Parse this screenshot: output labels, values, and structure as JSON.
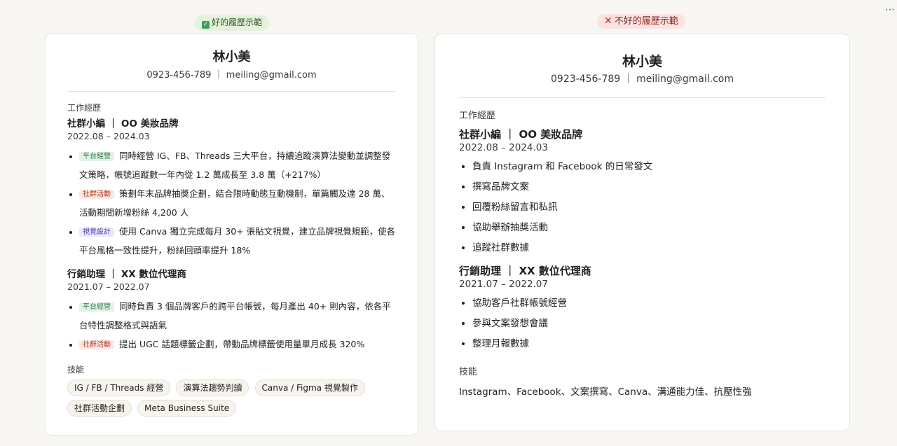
{
  "good_label": "好的履歷示範",
  "bad_label": "不好的履歷示範",
  "more_icon": "⋯",
  "good": {
    "name": "林小美",
    "contact": "0923-456-789 ｜ meiling@gmail.com",
    "section_work": "工作經歷",
    "jobs": [
      {
        "title": "社群小編 ｜ OO 美妝品牌",
        "period": "2022.08 – 2024.03",
        "bullets": [
          {
            "tag": "平台經營",
            "tag_color": "green",
            "text": "同時經營 IG、FB、Threads 三大平台，持續追蹤演算法變動並調整發文策略，帳號追蹤數一年內從 1.2 萬成長至 3.8 萬（+217%）"
          },
          {
            "tag": "社群活動",
            "tag_color": "red",
            "text": "策劃年末品牌抽獎企劃，結合限時動態互動機制，單篇觸及達 28 萬、活動期間新增粉絲 4,200 人"
          },
          {
            "tag": "視覺設計",
            "tag_color": "purple",
            "text": "使用 Canva 獨立完成每月 30+ 張貼文視覺，建立品牌視覺規範，使各平台風格一致性提升，粉絲回頭率提升 18%"
          }
        ]
      },
      {
        "title": "行銷助理 ｜ XX 數位代理商",
        "period": "2021.07 – 2022.07",
        "bullets": [
          {
            "tag": "平台經營",
            "tag_color": "green",
            "text": "同時負責 3 個品牌客戶的跨平台帳號，每月產出 40+ 則內容，依各平台特性調整格式與語氣"
          },
          {
            "tag": "社群活動",
            "tag_color": "red",
            "text": "提出 UGC 話題標籤企劃，帶動品牌標籤使用量單月成長 320%"
          }
        ]
      }
    ],
    "section_skills": "技能",
    "skills": [
      "IG / FB / Threads 經營",
      "演算法趨勢判讀",
      "Canva / Figma 視覺製作",
      "社群活動企劃",
      "Meta Business Suite"
    ]
  },
  "bad": {
    "name": "林小美",
    "contact": "0923-456-789 ｜ meiling@gmail.com",
    "section_work": "工作經歷",
    "jobs": [
      {
        "title": "社群小編 ｜ OO 美妝品牌",
        "period": "2022.08 – 2024.03",
        "bullets": [
          "負責 Instagram 和 Facebook 的日常發文",
          "撰寫品牌文案",
          "回覆粉絲留言和私訊",
          "協助舉辦抽獎活動",
          "追蹤社群數據"
        ]
      },
      {
        "title": "行銷助理 ｜ XX 數位代理商",
        "period": "2021.07 – 2022.07",
        "bullets": [
          "協助客戶社群帳號經營",
          "參與文案發想會議",
          "整理月報數據"
        ]
      }
    ],
    "section_skills": "技能",
    "skills_text": "Instagram、Facebook、文案撰寫、Canva、溝通能力佳、抗壓性強"
  }
}
